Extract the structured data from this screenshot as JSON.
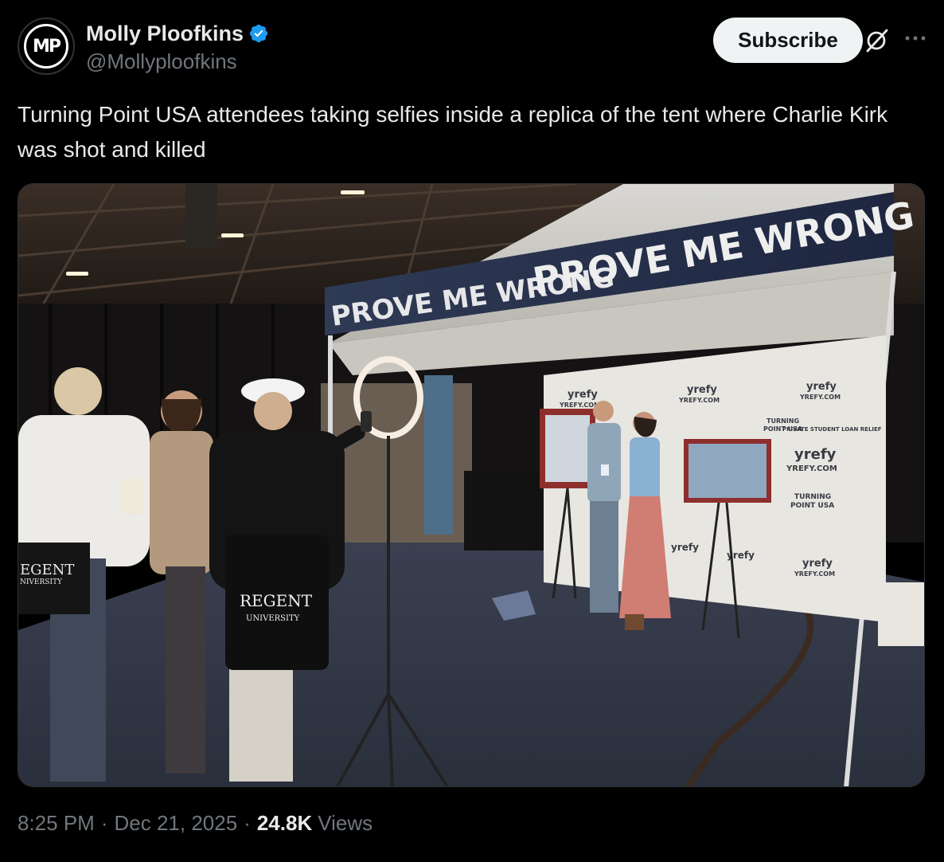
{
  "author": {
    "avatar_initials": "MP",
    "display_name": "Molly Ploofkins",
    "handle": "@Mollyploofkins",
    "verified": true
  },
  "actions": {
    "subscribe_label": "Subscribe"
  },
  "tweet": {
    "text": "Turning Point USA attendees taking selfies inside a replica of the tent where Charlie Kirk was shot and killed"
  },
  "media": {
    "banner_text_left": "PROVE ME WRONG",
    "banner_text_right": "PROVE ME WRONG",
    "bag_brand_front": "REGENT",
    "bag_brand_front_sub": "UNIVERSITY",
    "bag_brand_left": "EGENT",
    "bag_brand_left_sub": "NIVERSITY",
    "backdrop_brand": "yrefy",
    "backdrop_url": "YREFY.COM",
    "backdrop_logo_line1": "TURNING",
    "backdrop_logo_line2": "POINT USA",
    "backdrop_fineprint": "PRIVATE STUDENT LOAN RELIEF"
  },
  "meta": {
    "time": "8:25 PM",
    "separator": "·",
    "date": "Dec 21, 2025",
    "views_count": "24.8K",
    "views_label": "Views"
  },
  "colors": {
    "background": "#000000",
    "text_primary": "#e7e9ea",
    "text_secondary": "#71767b",
    "verified_blue": "#1d9bf0",
    "subscribe_bg": "#eff3f4"
  },
  "icons": {
    "verified": "verified-badge-icon",
    "grok": "grok-icon",
    "more": "more-icon"
  }
}
